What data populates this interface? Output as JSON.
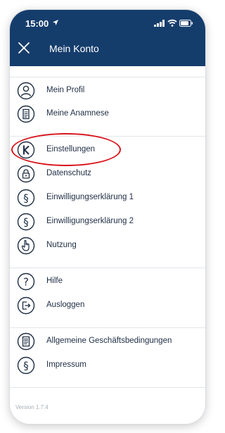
{
  "status_bar": {
    "time": "15:00"
  },
  "header": {
    "title": "Mein Konto"
  },
  "menu": {
    "group1": [
      {
        "label": "Mein Profil",
        "icon": "profile-icon"
      },
      {
        "label": "Meine Anamnese",
        "icon": "document-icon"
      }
    ],
    "group2": [
      {
        "label": "Einstellungen",
        "icon": "k-logo-icon"
      },
      {
        "label": "Datenschutz",
        "icon": "lock-icon"
      },
      {
        "label": "Einwilligungserklärung 1",
        "icon": "paragraph-icon"
      },
      {
        "label": "Einwilligungserklärung 2",
        "icon": "paragraph-icon"
      },
      {
        "label": "Nutzung",
        "icon": "hand-pointer-icon"
      }
    ],
    "group3": [
      {
        "label": "Hilfe",
        "icon": "help-icon"
      },
      {
        "label": "Ausloggen",
        "icon": "logout-icon"
      }
    ],
    "group4": [
      {
        "label": "Allgemeine Geschäftsbedingungen",
        "icon": "terms-document-icon"
      },
      {
        "label": "Impressum",
        "icon": "paragraph-icon"
      }
    ]
  },
  "footer": {
    "version": "Version 1.7.4"
  },
  "colors": {
    "header_bg": "#153d6c",
    "highlight": "#d9131b",
    "icon_stroke": "#1e2d44"
  }
}
